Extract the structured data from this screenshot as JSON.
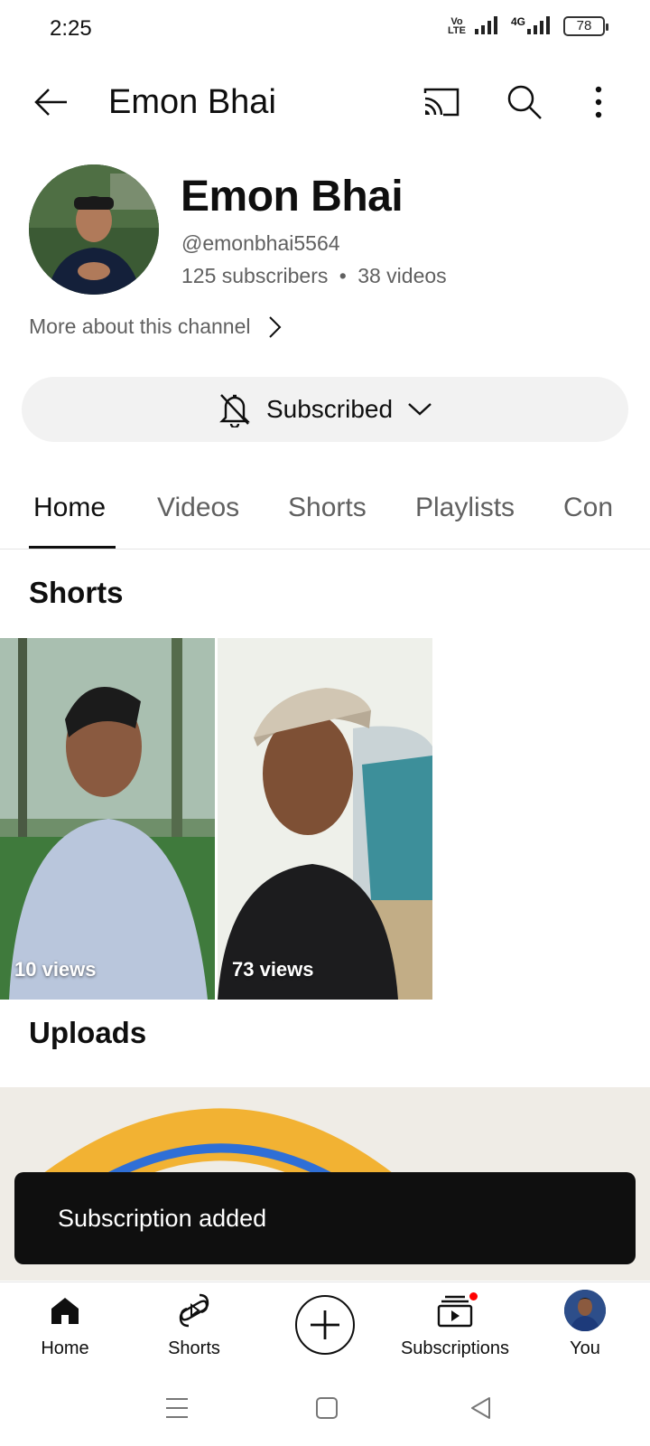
{
  "status_bar": {
    "time": "2:25",
    "volte": "Vo\nLTE",
    "network": "4G",
    "battery": "78"
  },
  "app_bar": {
    "title": "Emon Bhai"
  },
  "channel": {
    "name": "Emon Bhai",
    "handle": "@emonbhai5564",
    "subscribers": "125 subscribers",
    "separator": "•",
    "videos": "38 videos",
    "more_about": "More about this channel",
    "subscribe_label": "Subscribed"
  },
  "tabs": [
    {
      "label": "Home"
    },
    {
      "label": "Videos"
    },
    {
      "label": "Shorts"
    },
    {
      "label": "Playlists"
    },
    {
      "label": "Con"
    }
  ],
  "sections": {
    "shorts_title": "Shorts",
    "uploads_title": "Uploads"
  },
  "shorts": [
    {
      "views": "10 views"
    },
    {
      "views": "73 views"
    }
  ],
  "toast": {
    "message": "Subscription added"
  },
  "bottom_nav": {
    "home": "Home",
    "shorts": "Shorts",
    "subscriptions": "Subscriptions",
    "you": "You"
  },
  "colors": {
    "accent": "#ff0000",
    "text_primary": "#0f0f0f",
    "text_secondary": "#606060",
    "chip_bg": "#f2f2f2",
    "toast_bg": "#0f0f0f"
  }
}
